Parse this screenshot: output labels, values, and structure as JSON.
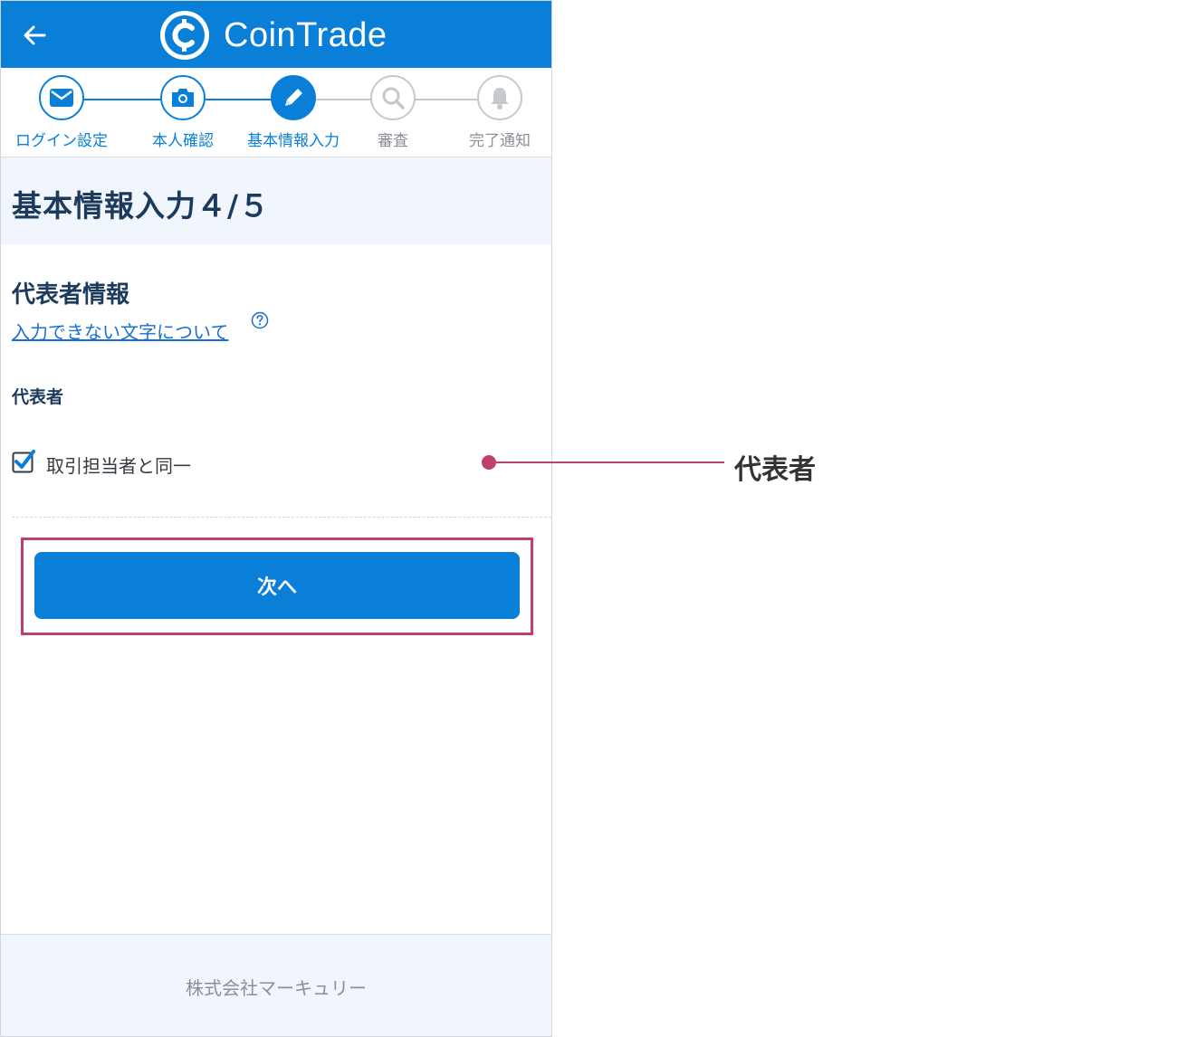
{
  "header": {
    "app_name": "CoinTrade",
    "back_icon": "arrow-left-icon",
    "logo_icon": "coin-logo-icon",
    "color": "#0a7fd8"
  },
  "stepper": {
    "steps": [
      {
        "label": "ログイン設定",
        "icon": "mail-icon",
        "state": "done"
      },
      {
        "label": "本人確認",
        "icon": "camera-icon",
        "state": "done"
      },
      {
        "label": "基本情報入力",
        "icon": "pencil-icon",
        "state": "active"
      },
      {
        "label": "審査",
        "icon": "search-icon",
        "state": "todo"
      },
      {
        "label": "完了通知",
        "icon": "bell-icon",
        "state": "todo"
      }
    ]
  },
  "page": {
    "title": "基本情報入力４/５",
    "section_title": "代表者情報",
    "help_link": "入力できない文字について",
    "field_label": "代表者",
    "checkbox": {
      "label": "取引担当者と同一",
      "checked": true
    },
    "next_button": "次へ"
  },
  "footer": {
    "company": "株式会社マーキュリー"
  },
  "annotation": {
    "label": "代表者",
    "color": "#c13f6b"
  }
}
